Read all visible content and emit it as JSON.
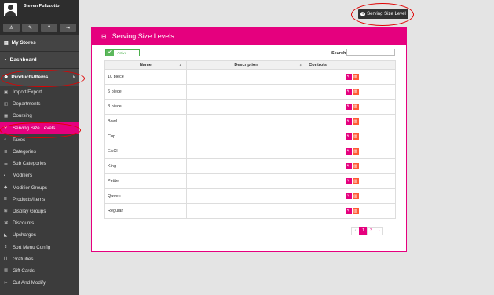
{
  "user": {
    "name": "Steven Pulizzotto"
  },
  "sidebar": {
    "quick_icons": [
      "user-icon",
      "wrench-icon",
      "help-icon",
      "signout-icon"
    ],
    "sections": [
      {
        "label": "My Stores"
      },
      {
        "label": "Dashboard"
      },
      {
        "label": "Products/Items"
      }
    ],
    "items": [
      {
        "label": "Import/Export"
      },
      {
        "label": "Departments"
      },
      {
        "label": "Coursing"
      },
      {
        "label": "Serving Size Levels"
      },
      {
        "label": "Taxes"
      },
      {
        "label": "Categories"
      },
      {
        "label": "Sub Categories"
      },
      {
        "label": "Modifiers"
      },
      {
        "label": "Modifier Groups"
      },
      {
        "label": "Products/Items"
      },
      {
        "label": "Display Groups"
      },
      {
        "label": "Discounts"
      },
      {
        "label": "Upcharges"
      },
      {
        "label": "Sort Menu Config"
      },
      {
        "label": "Gratuities"
      },
      {
        "label": "Gift Cards"
      },
      {
        "label": "Cut And Modify"
      }
    ]
  },
  "page": {
    "add_button": "Serving Size Level",
    "title": "Serving Size Levels",
    "active_toggle": "Active",
    "search_label": "Search",
    "search_placeholder": ""
  },
  "table": {
    "headers": {
      "name": "Name",
      "description": "Description",
      "controls": "Controls"
    },
    "rows": [
      {
        "name": "10 piece",
        "description": ""
      },
      {
        "name": "6 piece",
        "description": ""
      },
      {
        "name": "8 piece",
        "description": ""
      },
      {
        "name": "Bowl",
        "description": ""
      },
      {
        "name": "Cup",
        "description": ""
      },
      {
        "name": "EACH",
        "description": ""
      },
      {
        "name": "King",
        "description": ""
      },
      {
        "name": "Petite",
        "description": ""
      },
      {
        "name": "Queen",
        "description": ""
      },
      {
        "name": "Regular",
        "description": ""
      }
    ]
  },
  "pagination": {
    "prev": "‹",
    "pages": [
      "1",
      "2"
    ],
    "current": "1",
    "next": "›"
  },
  "colors": {
    "accent": "#e5007e",
    "delete": "#ff5a36",
    "active": "#5cb85c",
    "sidebar": "#3c3c3c",
    "annotation": "#e00000"
  }
}
